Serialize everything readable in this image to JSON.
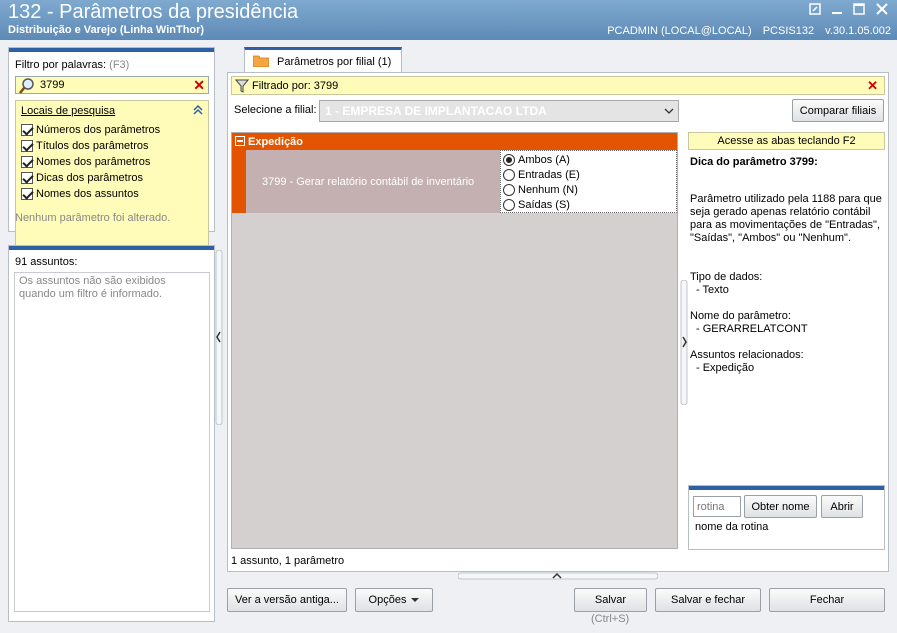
{
  "window": {
    "title": "132 - Parâmetros da presidência",
    "subtitle": "Distribuição e Varejo (Linha WinThor)",
    "user": "PCADMIN (LOCAL@LOCAL)",
    "program": "PCSIS132",
    "version": "v.30.1.05.002"
  },
  "left": {
    "filter_label": "Filtro por palavras:",
    "filter_shortcut": "(F3)",
    "filter_value": "3799",
    "locais_title": "Locais de pesquisa",
    "locais": [
      {
        "label": "Números dos parâmetros",
        "checked": true
      },
      {
        "label": "Títulos dos parâmetros",
        "checked": true
      },
      {
        "label": "Nomes dos parâmetros",
        "checked": true
      },
      {
        "label": "Dicas dos parâmetros",
        "checked": true
      },
      {
        "label": "Nomes dos assuntos",
        "checked": true
      }
    ],
    "no_change_note": "Nenhum parâmetro foi alterado.",
    "assuntos_count": "91 assuntos:",
    "assuntos_note": "Os assuntos não são exibidos quando um filtro é informado."
  },
  "tab": {
    "label": "Parâmetros por filial  (1)"
  },
  "filter_bar": {
    "text": "Filtrado por: 3799"
  },
  "filial": {
    "label": "Selecione a filial:",
    "value": "1 - EMPRESA DE IMPLANTACAO LTDA",
    "compare_button": "Comparar filiais"
  },
  "grid": {
    "group": "Expedição",
    "param": "3799 - Gerar relatório contábil de inventário",
    "options": [
      {
        "label": "Ambos (A)",
        "selected": true
      },
      {
        "label": "Entradas (E)",
        "selected": false
      },
      {
        "label": "Nenhum (N)",
        "selected": false
      },
      {
        "label": "Saídas (S)",
        "selected": false
      }
    ]
  },
  "tip": {
    "bar": "Acesse as abas teclando F2",
    "title": "Dica do parâmetro 3799:",
    "description": "Parâmetro utilizado pela 1188 para que seja gerado apenas relatório contábil para as movimentações de \"Entradas\", \"Saídas\", \"Ambos\" ou \"Nenhum\".",
    "tipo_label": "Tipo de dados:",
    "tipo_value": "- Texto",
    "nome_label": "Nome do parâmetro:",
    "nome_value": "- GERARRELATCONT",
    "assuntos_label": "Assuntos relacionados:",
    "assuntos_value": "- Expedição"
  },
  "rotina": {
    "placeholder": "rotina",
    "obter_button": "Obter nome",
    "abrir_button": "Abrir",
    "name_label": "nome da rotina"
  },
  "status": "1 assunto, 1 parâmetro",
  "footer": {
    "versao_button": "Ver a versão antiga...",
    "opcoes_button": "Opções",
    "salvar_button": "Salvar",
    "salvar_shortcut": "(Ctrl+S)",
    "salvar_fechar_button": "Salvar e fechar",
    "fechar_button": "Fechar"
  }
}
